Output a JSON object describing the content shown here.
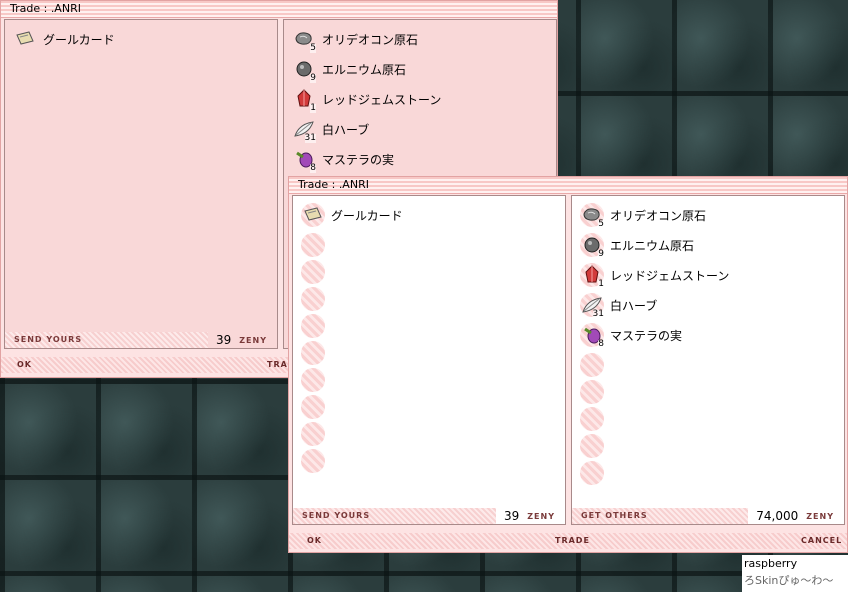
{
  "window_title": "Trade : .ANRI",
  "your_items": [
    {
      "name": "グールカード",
      "qty": "",
      "icon": "card-icon"
    }
  ],
  "other_items": [
    {
      "name": "オリデオコン原石",
      "qty": "5",
      "icon": "ore-icon"
    },
    {
      "name": "エルニウム原石",
      "qty": "9",
      "icon": "ore-icon"
    },
    {
      "name": "レッドジェムストーン",
      "qty": "1",
      "icon": "red-gem-icon"
    },
    {
      "name": "白ハーブ",
      "qty": "31",
      "icon": "herb-icon"
    },
    {
      "name": "マステラの実",
      "qty": "8",
      "icon": "fruit-icon"
    }
  ],
  "send_label": "SEND YOURS",
  "get_label": "GET OTHERS",
  "your_zeny": "39",
  "other_zeny": "74,000",
  "zeny_label": "ZENY",
  "buttons": {
    "ok": "OK",
    "trade": "TRADE",
    "cancel": "CANCEL"
  },
  "back_trade_partial": "TRAD",
  "credit": {
    "line1": "raspberry",
    "line2": "ろSkinぴゅ〜わ〜"
  },
  "colors": {
    "title_stripe": "#f8c8c6",
    "window_bg": "#fde3e3",
    "panel_pink": "#f9d8d8"
  }
}
